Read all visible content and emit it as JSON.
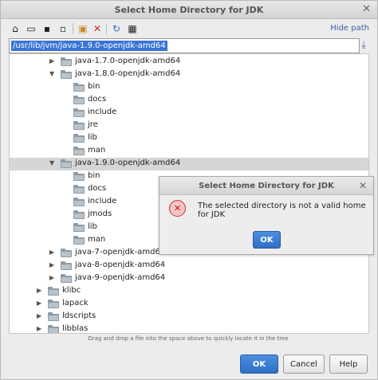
{
  "window": {
    "title": "Select Home Directory for JDK"
  },
  "toolbar": {
    "hide_path": "Hide path"
  },
  "path": {
    "value": "/usr/lib/jvm/java-1.9.0-openjdk-amd64"
  },
  "tree": {
    "items": [
      {
        "label": "java-1.7.0-openjdk-amd64",
        "expanded": false,
        "selected": false
      },
      {
        "label": "java-1.8.0-openjdk-amd64",
        "expanded": true,
        "selected": false
      },
      {
        "label": "bin"
      },
      {
        "label": "docs"
      },
      {
        "label": "include"
      },
      {
        "label": "jre"
      },
      {
        "label": "lib"
      },
      {
        "label": "man"
      },
      {
        "label": "java-1.9.0-openjdk-amd64",
        "expanded": true,
        "selected": true
      },
      {
        "label": "bin"
      },
      {
        "label": "docs"
      },
      {
        "label": "include"
      },
      {
        "label": "jmods"
      },
      {
        "label": "lib"
      },
      {
        "label": "man"
      },
      {
        "label": "java-7-openjdk-amd64",
        "expanded": false
      },
      {
        "label": "java-8-openjdk-amd64",
        "expanded": false
      },
      {
        "label": "java-9-openjdk-amd64",
        "expanded": false
      },
      {
        "label": "klibc",
        "expanded": false
      },
      {
        "label": "lapack",
        "expanded": false
      },
      {
        "label": "ldscripts",
        "expanded": false
      },
      {
        "label": "libblas",
        "expanded": false
      }
    ]
  },
  "hint": "Drag and drop a file into the space above to quickly locate it in the tree",
  "buttons": {
    "ok": "OK",
    "cancel": "Cancel",
    "help": "Help"
  },
  "alert": {
    "title": "Select Home Directory for JDK",
    "message": "The selected directory is not a valid home for JDK",
    "ok": "OK"
  }
}
